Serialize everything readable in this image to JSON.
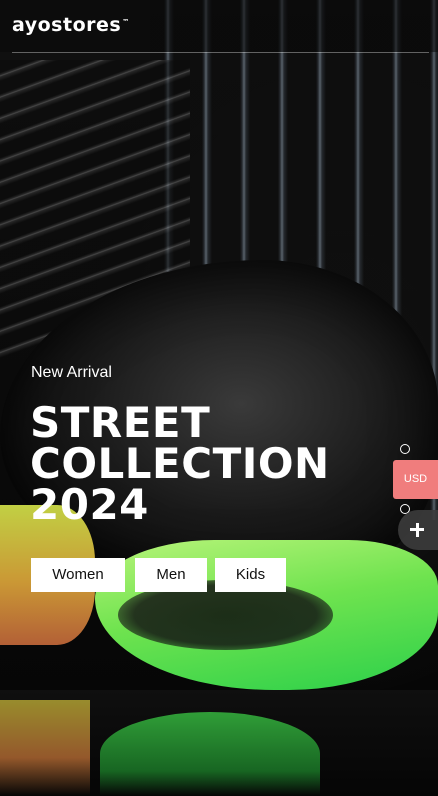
{
  "header": {
    "logo": "ayostores",
    "logo_tm": "™"
  },
  "hero": {
    "eyebrow": "New Arrival",
    "headline_line1": "STREET",
    "headline_line2": "COLLECTION",
    "headline_line3": "2024"
  },
  "categories": [
    {
      "label": "Women"
    },
    {
      "label": "Men"
    },
    {
      "label": "Kids"
    }
  ],
  "widgets": {
    "currency": "USD"
  },
  "icons": [
    "plus-icon",
    "radio-dot"
  ],
  "colors": {
    "currency_bg": "#f07d7d",
    "sole_green": "#6fe34f"
  }
}
